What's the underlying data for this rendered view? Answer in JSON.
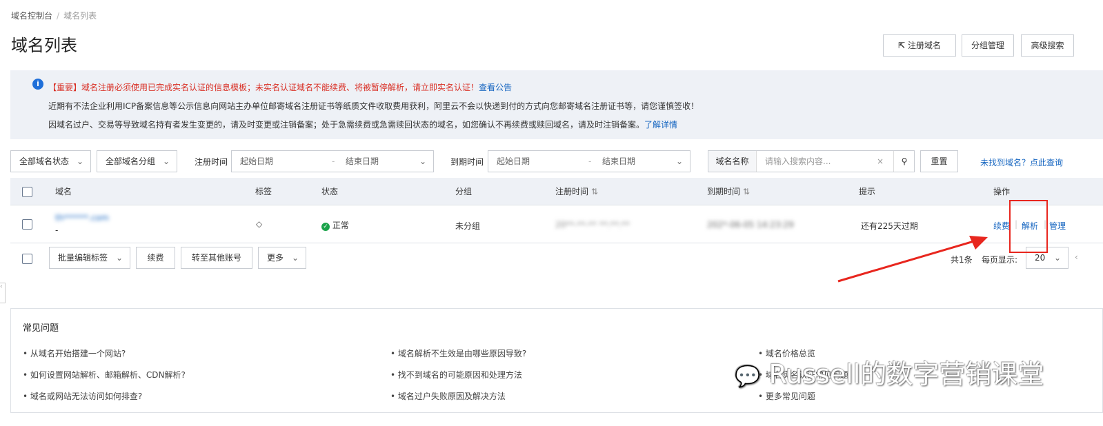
{
  "breadcrumb": [
    "域名控制台",
    "域名列表"
  ],
  "page_title": "域名列表",
  "header_buttons": {
    "register": "注册域名",
    "group": "分组管理",
    "advanced": "高级搜索"
  },
  "notice": {
    "tag": "【重要】",
    "line1": "域名注册必须使用已完成实名认证的信息模板；未实名认证域名不能续费、将被暂停解析，请立即实名认证！",
    "line1_link": "查看公告",
    "line2": "近期有不法企业利用ICP备案信息等公示信息向网站主办单位邮寄域名注册证书等纸质文件收取费用获利，阿里云不会以快递到付的方式向您邮寄域名注册证书等，请您谨慎签收！",
    "line3": "因域名过户、交易等导致域名持有者发生变更的，请及时变更或注销备案；处于急需续费或急需赎回状态的域名，如您确认不再续费或赎回域名，请及时注销备案。",
    "line3_link": "了解详情"
  },
  "filters": {
    "status": "全部域名状态",
    "group": "全部域名分组",
    "reg_label": "注册时间",
    "exp_label": "到期时间",
    "start_placeholder": "起始日期",
    "end_placeholder": "结束日期",
    "search_field": "域名名称",
    "search_placeholder": "请输入搜索内容...",
    "reset": "重置",
    "not_found": "未找到域名？点此查询"
  },
  "table": {
    "columns": [
      "域名",
      "标签",
      "状态",
      "分组",
      "注册时间",
      "到期时间",
      "提示",
      "操作"
    ],
    "rows": [
      {
        "domain": "th******.com",
        "domain_sub": "-",
        "status": "正常",
        "group": "未分组",
        "reg_time": "20**-**-** **:**:**",
        "exp_time": "202*-06-05 14:23:29",
        "hint": "还有225天过期",
        "actions": [
          "续费",
          "解析",
          "管理"
        ]
      }
    ]
  },
  "batch": {
    "edit_tags": "批量编辑标签",
    "renew": "续费",
    "transfer": "转至其他账号",
    "more": "更多",
    "total": "共1条",
    "per_page_label": "每页显示:",
    "per_page": "20"
  },
  "faq": {
    "title": "常见问题",
    "items": [
      "从域名开始搭建一个网站?",
      "如何设置网站解析、邮箱解析、CDN解析?",
      "域名或网站无法访问如何排查?",
      "域名解析不生效是由哪些原因导致?",
      "找不到域名的可能原因和处理方法",
      "域名过户失败原因及解决方法",
      "域名价格总览",
      "域名实名认证常见问题",
      "更多常见问题"
    ]
  },
  "watermark": "Russell的数字营销课堂",
  "colors": {
    "accent": "#1565c0",
    "highlight": "#e8261e",
    "success": "#1aa34a"
  }
}
